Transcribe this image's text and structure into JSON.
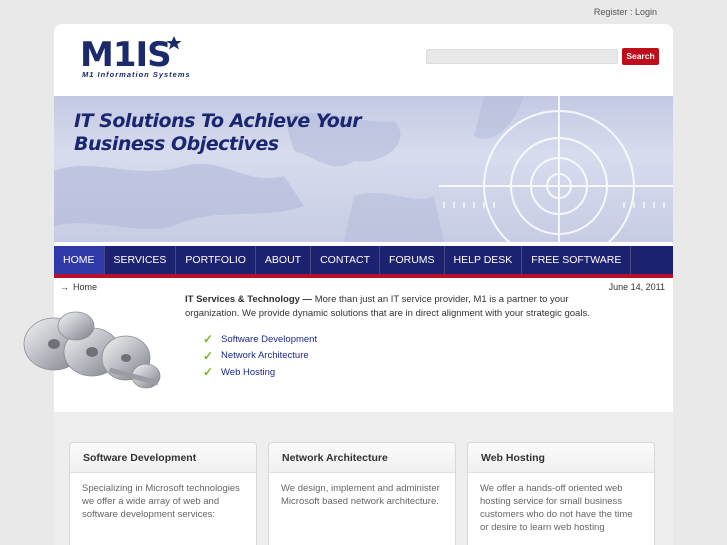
{
  "toplinks": {
    "register": "Register",
    "sep": ":",
    "login": "Login"
  },
  "logo": {
    "mark": "M1IS",
    "subtitle": "M1 Information Systems"
  },
  "search": {
    "placeholder": "",
    "button": "Search"
  },
  "banner": {
    "line1": "IT Solutions To Achieve Your",
    "line2": "Business Objectives"
  },
  "nav": [
    "HOME",
    "SERVICES",
    "PORTFOLIO",
    "ABOUT",
    "CONTACT",
    "FORUMS",
    "HELP DESK",
    "FREE SOFTWARE"
  ],
  "breadcrumb": {
    "home": "Home"
  },
  "date": "June 14, 2011",
  "intro": {
    "lead": "IT Services & Technology —",
    "text": " More than just an IT service provider, M1 is a partner to your organization. We provide dynamic solutions that are in direct alignment with your strategic goals."
  },
  "checklist": [
    "Software Development",
    "Network Architecture",
    "Web Hosting"
  ],
  "cards": [
    {
      "title": "Software Development",
      "body": "Specializing in Microsoft technologies we offer a wide array of web and software development services:"
    },
    {
      "title": "Network Architecture",
      "body": "We design, implement and administer Microsoft based network architecture."
    },
    {
      "title": "Web Hosting",
      "body": "We offer a hands-off oriented web hosting service for small business customers who do not have the time or desire to learn web hosting"
    }
  ],
  "colors": {
    "nav_bg": "#1d2270",
    "accent_red": "#b8102c",
    "link": "#1b2a8a",
    "check_green": "#7ab51d",
    "title_blue": "#1a2670"
  },
  "icons": {
    "breadcrumb_arrow": "right-arrow-icon",
    "check": "check-mark-icon"
  }
}
